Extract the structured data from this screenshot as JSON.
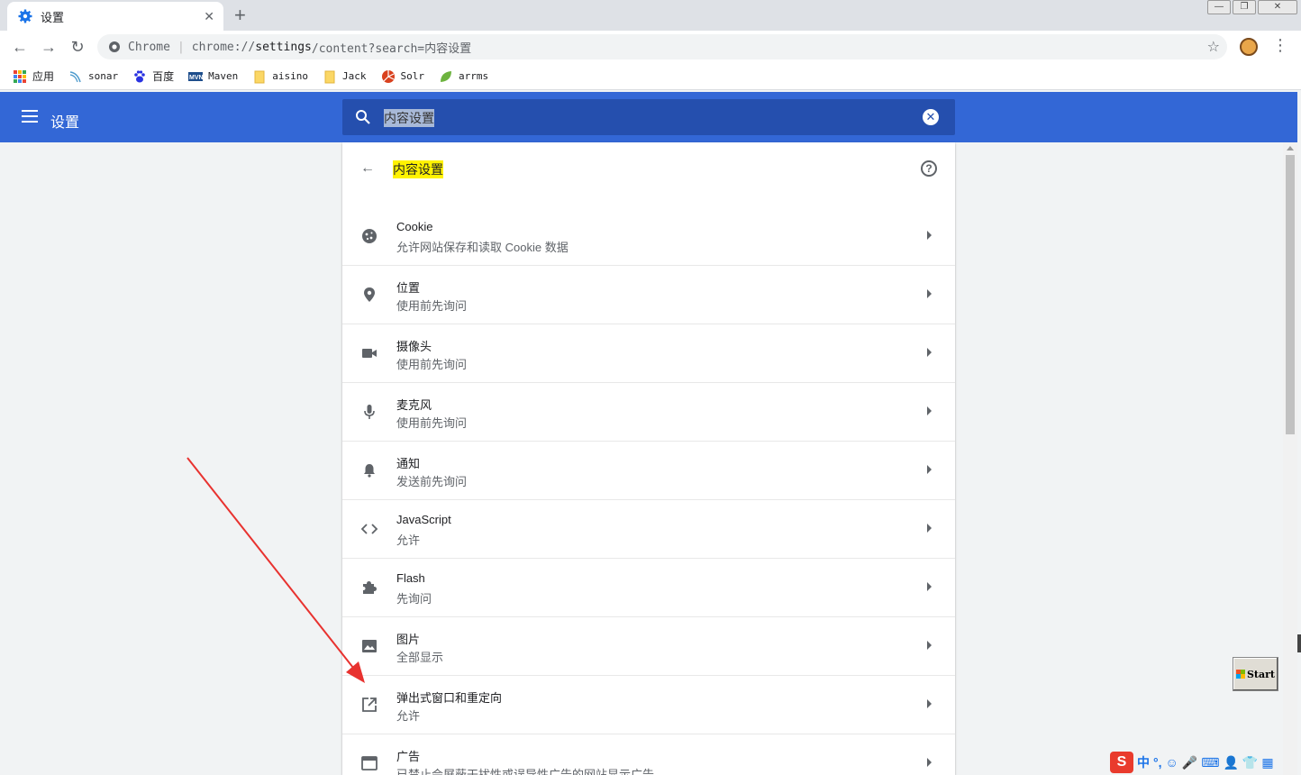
{
  "browser": {
    "tab_title": "设置",
    "address_brand": "Chrome",
    "address_url_prefix": "chrome://",
    "address_url_bold": "settings",
    "address_url_rest": "/content?search=内容设置"
  },
  "bookmarks": [
    {
      "label": "应用",
      "icon": "apps-grid-icon"
    },
    {
      "label": "sonar",
      "icon": "sonar-icon"
    },
    {
      "label": "百度",
      "icon": "baidu-paw-icon"
    },
    {
      "label": "Maven",
      "icon": "maven-icon"
    },
    {
      "label": "aisino",
      "icon": "folder-icon"
    },
    {
      "label": "Jack",
      "icon": "folder-icon"
    },
    {
      "label": "Solr",
      "icon": "solr-icon"
    },
    {
      "label": "arrms",
      "icon": "leaf-icon"
    }
  ],
  "settings_header": {
    "title": "设置",
    "search_value": "内容设置"
  },
  "content_settings": {
    "title": "内容设置",
    "items": [
      {
        "title": "Cookie",
        "subtitle": "允许网站保存和读取 Cookie 数据",
        "icon": "cookie-icon"
      },
      {
        "title": "位置",
        "subtitle": "使用前先询问",
        "icon": "location-pin-icon"
      },
      {
        "title": "摄像头",
        "subtitle": "使用前先询问",
        "icon": "camera-icon"
      },
      {
        "title": "麦克风",
        "subtitle": "使用前先询问",
        "icon": "microphone-icon"
      },
      {
        "title": "通知",
        "subtitle": "发送前先询问",
        "icon": "bell-icon"
      },
      {
        "title": "JavaScript",
        "subtitle": "允许",
        "icon": "code-icon"
      },
      {
        "title": "Flash",
        "subtitle": "先询问",
        "icon": "puzzle-icon"
      },
      {
        "title": "图片",
        "subtitle": "全部显示",
        "icon": "image-icon"
      },
      {
        "title": "弹出式窗口和重定向",
        "subtitle": "允许",
        "icon": "open-in-new-icon"
      },
      {
        "title": "广告",
        "subtitle": "已禁止会屏蔽干扰性或误导性广告的网站显示广告",
        "icon": "ad-window-icon"
      }
    ]
  },
  "overlay": {
    "start_label": "Start",
    "ime_chinese": "中",
    "ime_punct": "°,"
  },
  "colors": {
    "header_blue": "#3367d6",
    "search_blue": "#254fae",
    "highlight_yellow": "#fff200",
    "annotation_red": "#e8322f"
  }
}
